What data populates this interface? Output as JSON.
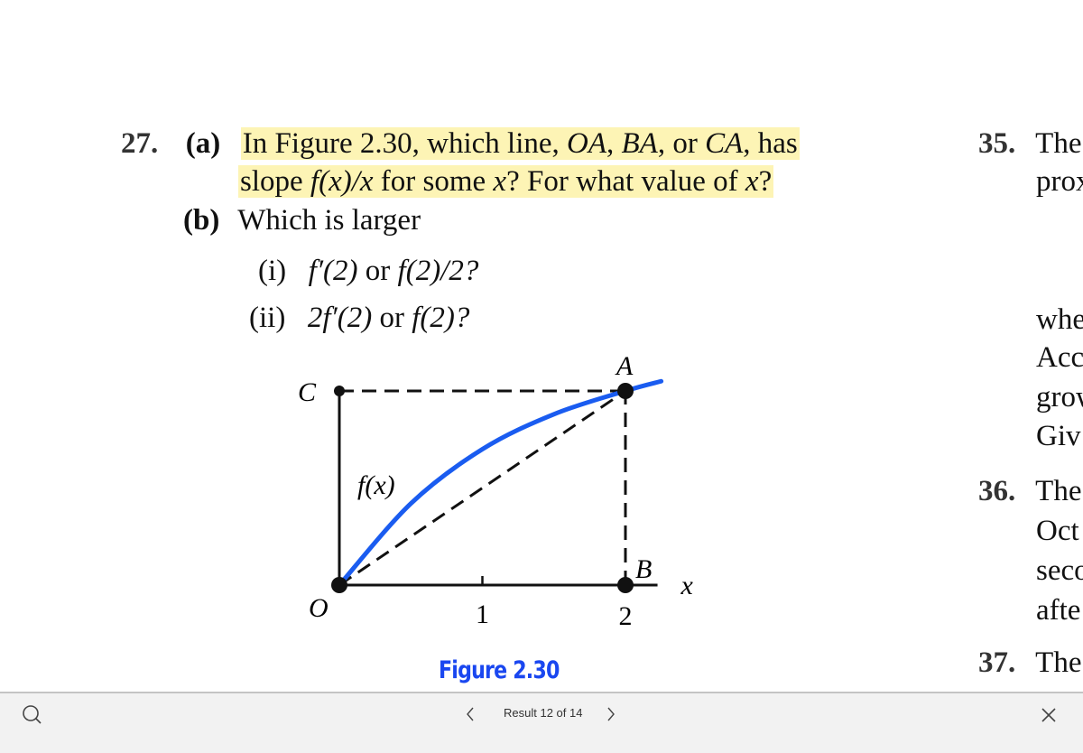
{
  "document": {
    "problem27": {
      "number": "27.",
      "part_a_label": "(a)",
      "part_a_line1": {
        "text_pre": "In Figure 2.30, which line, ",
        "OA": "OA",
        "sep1": ", ",
        "BA": "BA",
        "sep2": ", or ",
        "CA": "CA",
        "text_post": ", has"
      },
      "part_a_line2": {
        "pre": "slope ",
        "expr": "f(x)/x",
        "mid": " for some ",
        "x1": "x",
        "mid2": "? For what value of ",
        "x2": "x",
        "post": "?"
      },
      "part_b_label": "(b)",
      "part_b_text": "Which is larger",
      "sub_i_label": "(i)",
      "sub_i_expr1": "f′(2)",
      "sub_i_or": " or ",
      "sub_i_expr2": "f(2)/2?",
      "sub_ii_label": "(ii)",
      "sub_ii_expr1": "2f′(2)",
      "sub_ii_or": " or ",
      "sub_ii_expr2": "f(2)?",
      "highlight_color": "#fdf4b5"
    },
    "figure": {
      "caption": "Figure 2.30",
      "caption_color": "#1a47f0",
      "curve_color": "#1a5cf0",
      "labels": {
        "A": "A",
        "B": "B",
        "C": "C",
        "O": "O",
        "fx": "f(x)",
        "x_axis": "x",
        "tick1": "1",
        "tick2": "2"
      }
    },
    "right_column": {
      "item35_number": "35.",
      "item35_line1": "The",
      "item35_line2": "prox",
      "line_whe": "whe",
      "line_acc": "Acc",
      "line_grow": "grow",
      "line_giv": "Giv",
      "item36_number": "36.",
      "item36_line1": "The",
      "item36_line2": "Oct",
      "item36_line3": "seco",
      "item36_line4": "afte",
      "item37_number": "37.",
      "item37_line1": "The"
    }
  },
  "search_bar": {
    "search_icon": "search-icon",
    "prev_icon": "chevron-left-icon",
    "result_text": "Result 12 of 14",
    "next_icon": "chevron-right-icon",
    "close_icon": "close-icon"
  },
  "chart_data": {
    "type": "line",
    "title": "Figure 2.30",
    "xlabel": "x",
    "ylabel": "",
    "x_ticks": [
      "1",
      "2"
    ],
    "xlim": [
      0,
      2.3
    ],
    "series": [
      {
        "name": "f(x)",
        "kind": "concave-increasing curve",
        "x": [
          0,
          0.5,
          1,
          1.5,
          2,
          2.25
        ],
        "y": [
          0,
          0.42,
          0.7,
          0.88,
          1.0,
          1.05
        ]
      }
    ],
    "points": [
      {
        "label": "O",
        "x": 0,
        "y": 0
      },
      {
        "label": "B",
        "x": 2,
        "y": 0
      },
      {
        "label": "A",
        "x": 2,
        "y": 1.0
      },
      {
        "label": "C",
        "x": 0,
        "y": 1.0
      }
    ],
    "dashed_lines": [
      "OA",
      "BA",
      "CA"
    ]
  }
}
